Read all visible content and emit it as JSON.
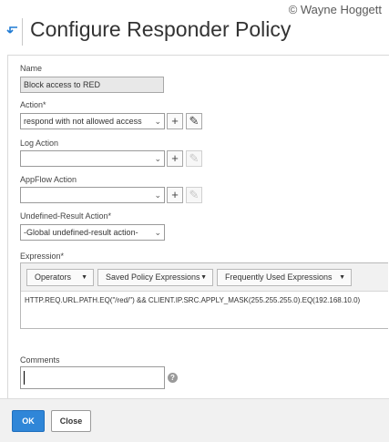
{
  "watermark": "© Wayne Hoggett",
  "header": {
    "title": "Configure Responder Policy"
  },
  "form": {
    "name": {
      "label": "Name",
      "value": "Block access to RED"
    },
    "action": {
      "label": "Action*",
      "value": "respond with not allowed access"
    },
    "log_action": {
      "label": "Log Action",
      "value": ""
    },
    "appflow_action": {
      "label": "AppFlow Action",
      "value": ""
    },
    "undefined_result_action": {
      "label": "Undefined-Result Action*",
      "value": "-Global undefined-result action-"
    },
    "expression": {
      "label": "Expression*",
      "toolbar": [
        "Operators",
        "Saved Policy Expressions",
        "Frequently Used Expressions"
      ],
      "value": "HTTP.REQ.URL.PATH.EQ(\"/red/\") && CLIENT.IP.SRC.APPLY_MASK(255.255.255.0).EQ(192.168.10.0)"
    },
    "comments": {
      "label": "Comments",
      "value": ""
    },
    "help_glyph": "?",
    "add_glyph": "+",
    "edit_glyph": "✎",
    "dropdown_glyph": "⌄",
    "menu_glyph": "▼"
  },
  "footer": {
    "ok_label": "OK",
    "close_label": "Close"
  },
  "colors": {
    "primary": "#2f86d8",
    "footer_bg": "#f1f1f1",
    "back_arrow": "#1f7ad3"
  },
  "icons": {
    "back": "back-arrow-icon",
    "add": "plus-icon",
    "edit": "pencil-icon",
    "help": "question-icon"
  }
}
